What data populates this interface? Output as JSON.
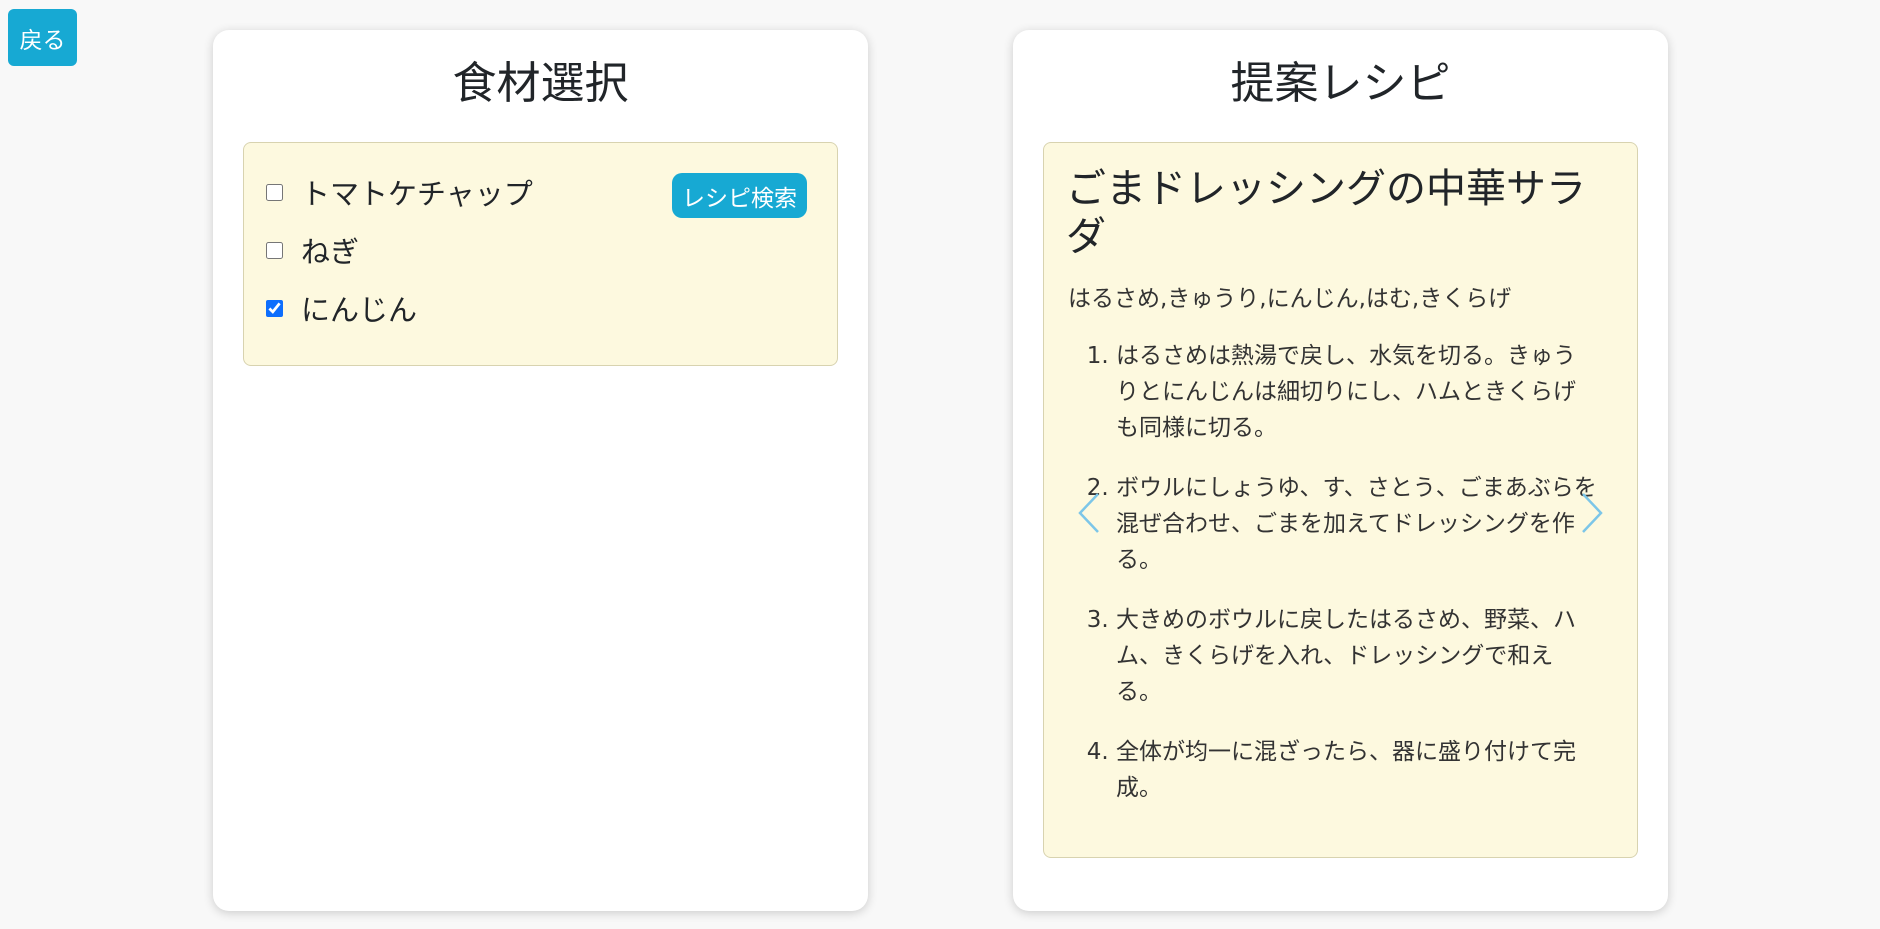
{
  "back_button": {
    "label": "戻る"
  },
  "left_panel": {
    "title": "食材選択",
    "search_button_label": "レシピ検索",
    "ingredients": [
      {
        "label": "トマトケチャップ",
        "checked": false
      },
      {
        "label": "ねぎ",
        "checked": false
      },
      {
        "label": "にんじん",
        "checked": true
      }
    ]
  },
  "right_panel": {
    "title": "提案レシピ",
    "recipe": {
      "title": "ごまドレッシングの中華サラダ",
      "ingredients": "はるさめ,きゅうり,にんじん,はむ,きくらげ",
      "steps": [
        "はるさめは熱湯で戻し、水気を切る。きゅうりとにんじんは細切りにし、ハムときくらげも同様に切る。",
        "ボウルにしょうゆ、す、さとう、ごまあぶらを混ぜ合わせ、ごまを加えてドレッシングを作る。",
        "大きめのボウルに戻したはるさめ、野菜、ハム、きくらげを入れ、ドレッシングで和える。",
        "全体が均一に混ざったら、器に盛り付けて完成。"
      ]
    },
    "prev_icon": "chevron-left-icon",
    "next_icon": "chevron-right-icon"
  },
  "colors": {
    "accent": "#17a9d3",
    "box_background": "#fdf9df",
    "checkbox": "#0d6efd",
    "arrow": "#7cc6e8"
  }
}
